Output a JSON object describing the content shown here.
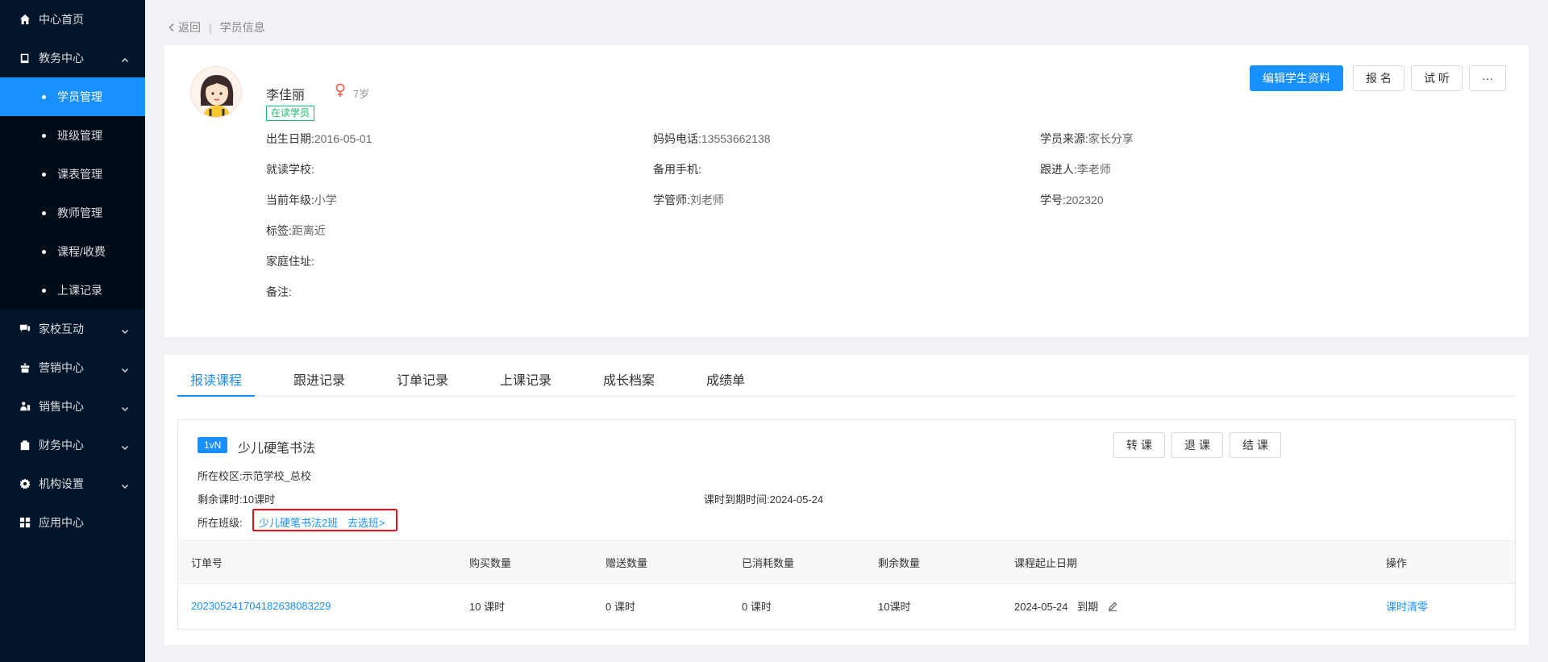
{
  "sidebar": {
    "items": [
      {
        "label": "中心首页",
        "icon": "home-icon"
      },
      {
        "label": "教务中心",
        "icon": "book-icon",
        "expanded": true,
        "children": [
          {
            "label": "学员管理",
            "active": true
          },
          {
            "label": "班级管理"
          },
          {
            "label": "课表管理"
          },
          {
            "label": "教师管理"
          },
          {
            "label": "课程/收费"
          },
          {
            "label": "上课记录"
          }
        ]
      },
      {
        "label": "家校互动",
        "icon": "chat-icon"
      },
      {
        "label": "营销中心",
        "icon": "gift-icon"
      },
      {
        "label": "销售中心",
        "icon": "sales-icon"
      },
      {
        "label": "财务中心",
        "icon": "finance-icon"
      },
      {
        "label": "机构设置",
        "icon": "gear-icon"
      },
      {
        "label": "应用中心",
        "icon": "apps-icon"
      }
    ]
  },
  "breadcrumb": {
    "back": "返回",
    "separator": "|",
    "current": "学员信息"
  },
  "student": {
    "name": "李佳丽",
    "age": "7岁",
    "status": "在读学员",
    "gender_color": "#f5614f",
    "fields": {
      "birth": {
        "label": "出生日期:",
        "value": "2016-05-01"
      },
      "mom_phone": {
        "label": "妈妈电话:",
        "value": "13553662138"
      },
      "source": {
        "label": "学员来源:",
        "value": "家长分享"
      },
      "school": {
        "label": "就读学校:",
        "value": ""
      },
      "backup_phone": {
        "label": "备用手机:",
        "value": ""
      },
      "follower": {
        "label": "跟进人:",
        "value": "李老师"
      },
      "grade": {
        "label": "当前年级:",
        "value": "小学"
      },
      "manager": {
        "label": "学管师:",
        "value": "刘老师"
      },
      "student_no": {
        "label": "学号:",
        "value": "202320"
      },
      "tags": {
        "label": "标签:",
        "value": "距离近"
      },
      "address": {
        "label": "家庭住址:",
        "value": ""
      },
      "remark": {
        "label": "备注:",
        "value": ""
      }
    }
  },
  "actions": {
    "edit": "编辑学生资料",
    "enroll": "报 名",
    "trial": "试 听",
    "more": "···"
  },
  "tabs": [
    "报读课程",
    "跟进记录",
    "订单记录",
    "上课记录",
    "成长档案",
    "成绩单"
  ],
  "course": {
    "badge": "1vN",
    "name": "少儿硬笔书法",
    "buttons": {
      "transfer": "转 课",
      "refund": "退 课",
      "finish": "结 课"
    },
    "campus": {
      "label": "所在校区:",
      "value": "示范学校_总校"
    },
    "remaining": {
      "label": "剩余课时:",
      "value": "10课时"
    },
    "expire": {
      "label": "课时到期时间:",
      "value": "2024-05-24"
    },
    "class_label": "所在班级:",
    "class_name": "少儿硬笔书法2班",
    "class_action": "去选班>"
  },
  "table": {
    "headers": [
      "订单号",
      "购买数量",
      "赠送数量",
      "已消耗数量",
      "剩余数量",
      "课程起止日期",
      "操作"
    ],
    "rows": [
      {
        "order_no": "20230524170418263808322​9",
        "buy": "10 课时",
        "gift": "0 课时",
        "used": "0 课时",
        "left": "10课时",
        "date": "2024-05-24",
        "date_suffix": "到期",
        "action": "课时清零"
      }
    ]
  },
  "colors": {
    "primary": "#1890ff",
    "sidebar_bg": "#001529",
    "highlight": "#e8101a",
    "status": "#19be6b"
  }
}
